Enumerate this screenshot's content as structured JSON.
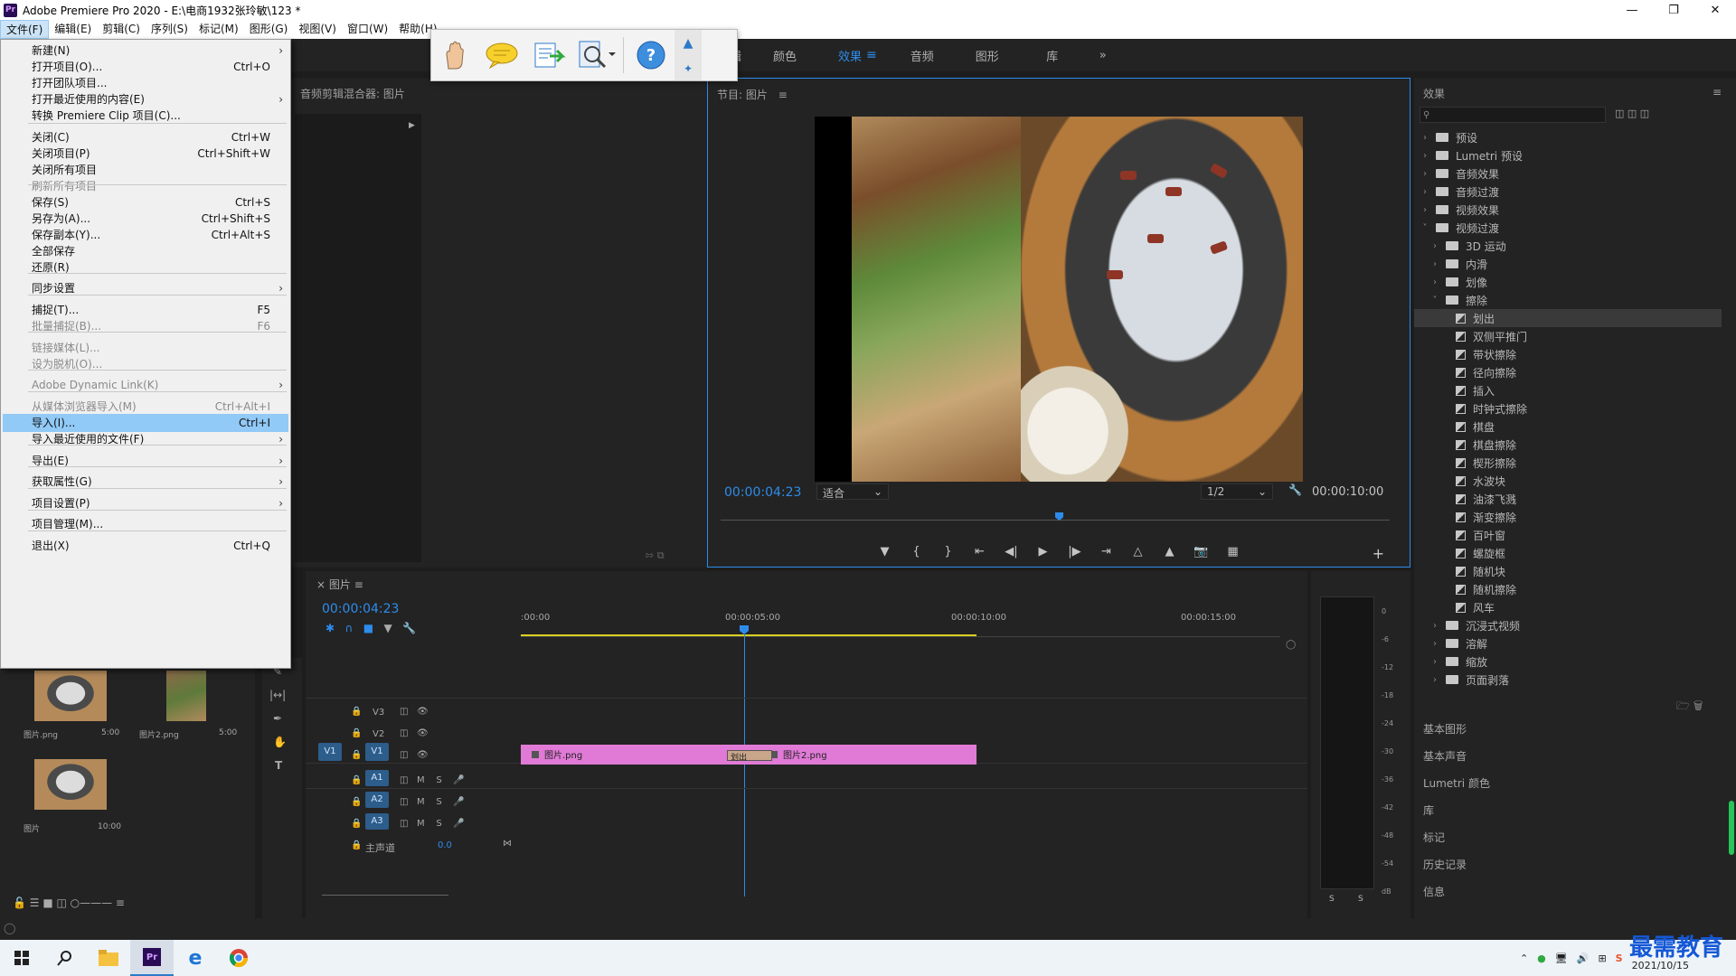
{
  "app": {
    "title": "Adobe Premiere Pro 2020 - E:\\电商1932张玲敏\\123 *"
  },
  "menubar": [
    "文件(F)",
    "编辑(E)",
    "剪辑(C)",
    "序列(S)",
    "标记(M)",
    "图形(G)",
    "视图(V)",
    "窗口(W)",
    "帮助(H)"
  ],
  "workspaces": [
    "编辑",
    "颜色",
    "效果",
    "音频",
    "图形",
    "库"
  ],
  "file_menu": [
    {
      "label": "新建(N)",
      "shortcut": "",
      "submenu": true,
      "disabled": false
    },
    {
      "label": "打开项目(O)...",
      "shortcut": "Ctrl+O",
      "submenu": false,
      "disabled": false
    },
    {
      "label": "打开团队项目...",
      "shortcut": "",
      "submenu": false,
      "disabled": false
    },
    {
      "label": "打开最近使用的内容(E)",
      "shortcut": "",
      "submenu": true,
      "disabled": false
    },
    {
      "label": "转换 Premiere Clip 项目(C)...",
      "shortcut": "",
      "submenu": false,
      "disabled": false
    },
    {
      "label": "关闭(C)",
      "shortcut": "Ctrl+W",
      "submenu": false,
      "disabled": false
    },
    {
      "label": "关闭项目(P)",
      "shortcut": "Ctrl+Shift+W",
      "submenu": false,
      "disabled": false
    },
    {
      "label": "关闭所有项目",
      "shortcut": "",
      "submenu": false,
      "disabled": false
    },
    {
      "label": "刷新所有项目",
      "shortcut": "",
      "submenu": false,
      "disabled": true
    },
    {
      "label": "保存(S)",
      "shortcut": "Ctrl+S",
      "submenu": false,
      "disabled": false
    },
    {
      "label": "另存为(A)...",
      "shortcut": "Ctrl+Shift+S",
      "submenu": false,
      "disabled": false
    },
    {
      "label": "保存副本(Y)...",
      "shortcut": "Ctrl+Alt+S",
      "submenu": false,
      "disabled": false
    },
    {
      "label": "全部保存",
      "shortcut": "",
      "submenu": false,
      "disabled": false
    },
    {
      "label": "还原(R)",
      "shortcut": "",
      "submenu": false,
      "disabled": false
    },
    {
      "label": "同步设置",
      "shortcut": "",
      "submenu": true,
      "disabled": false
    },
    {
      "label": "捕捉(T)...",
      "shortcut": "F5",
      "submenu": false,
      "disabled": false
    },
    {
      "label": "批量捕捉(B)...",
      "shortcut": "F6",
      "submenu": false,
      "disabled": true
    },
    {
      "label": "链接媒体(L)...",
      "shortcut": "",
      "submenu": false,
      "disabled": true
    },
    {
      "label": "设为脱机(O)...",
      "shortcut": "",
      "submenu": false,
      "disabled": true
    },
    {
      "label": "Adobe Dynamic Link(K)",
      "shortcut": "",
      "submenu": true,
      "disabled": true
    },
    {
      "label": "从媒体浏览器导入(M)",
      "shortcut": "Ctrl+Alt+I",
      "submenu": false,
      "disabled": true
    },
    {
      "label": "导入(I)...",
      "shortcut": "Ctrl+I",
      "submenu": false,
      "disabled": false
    },
    {
      "label": "导入最近使用的文件(F)",
      "shortcut": "",
      "submenu": true,
      "disabled": false
    },
    {
      "label": "导出(E)",
      "shortcut": "",
      "submenu": true,
      "disabled": false
    },
    {
      "label": "获取属性(G)",
      "shortcut": "",
      "submenu": true,
      "disabled": false
    },
    {
      "label": "项目设置(P)",
      "shortcut": "",
      "submenu": true,
      "disabled": false
    },
    {
      "label": "项目管理(M)...",
      "shortcut": "",
      "submenu": false,
      "disabled": false
    },
    {
      "label": "退出(X)",
      "shortcut": "Ctrl+Q",
      "submenu": false,
      "disabled": false
    }
  ],
  "mixer": {
    "title": "音频剪辑混合器: 图片"
  },
  "program": {
    "title": "节目: 图片",
    "timecode": "00:00:04:23",
    "fit": "适合",
    "resolution": "1/2",
    "duration": "00:00:10:00"
  },
  "effects": {
    "title": "效果",
    "tree": [
      {
        "label": "预设",
        "level": 0,
        "type": "folder",
        "open": false
      },
      {
        "label": "Lumetri 预设",
        "level": 0,
        "type": "folder",
        "open": false
      },
      {
        "label": "音频效果",
        "level": 0,
        "type": "folder",
        "open": false
      },
      {
        "label": "音频过渡",
        "level": 0,
        "type": "folder",
        "open": false
      },
      {
        "label": "视频效果",
        "level": 0,
        "type": "folder",
        "open": false
      },
      {
        "label": "视频过渡",
        "level": 0,
        "type": "folder",
        "open": true
      },
      {
        "label": "3D 运动",
        "level": 1,
        "type": "folder",
        "open": false
      },
      {
        "label": "内滑",
        "level": 1,
        "type": "folder",
        "open": false
      },
      {
        "label": "划像",
        "level": 1,
        "type": "folder",
        "open": false
      },
      {
        "label": "擦除",
        "level": 1,
        "type": "folder",
        "open": true
      },
      {
        "label": "划出",
        "level": 2,
        "type": "fx",
        "selected": true
      },
      {
        "label": "双侧平推门",
        "level": 2,
        "type": "fx"
      },
      {
        "label": "带状擦除",
        "level": 2,
        "type": "fx"
      },
      {
        "label": "径向擦除",
        "level": 2,
        "type": "fx"
      },
      {
        "label": "插入",
        "level": 2,
        "type": "fx"
      },
      {
        "label": "时钟式擦除",
        "level": 2,
        "type": "fx"
      },
      {
        "label": "棋盘",
        "level": 2,
        "type": "fx"
      },
      {
        "label": "棋盘擦除",
        "level": 2,
        "type": "fx"
      },
      {
        "label": "楔形擦除",
        "level": 2,
        "type": "fx"
      },
      {
        "label": "水波块",
        "level": 2,
        "type": "fx"
      },
      {
        "label": "油漆飞溅",
        "level": 2,
        "type": "fx"
      },
      {
        "label": "渐变擦除",
        "level": 2,
        "type": "fx"
      },
      {
        "label": "百叶窗",
        "level": 2,
        "type": "fx"
      },
      {
        "label": "螺旋框",
        "level": 2,
        "type": "fx"
      },
      {
        "label": "随机块",
        "level": 2,
        "type": "fx"
      },
      {
        "label": "随机擦除",
        "level": 2,
        "type": "fx"
      },
      {
        "label": "风车",
        "level": 2,
        "type": "fx"
      },
      {
        "label": "沉浸式视频",
        "level": 1,
        "type": "folder",
        "open": false
      },
      {
        "label": "溶解",
        "level": 1,
        "type": "folder",
        "open": false
      },
      {
        "label": "缩放",
        "level": 1,
        "type": "folder",
        "open": false
      },
      {
        "label": "页面剥落",
        "level": 1,
        "type": "folder",
        "open": false
      }
    ],
    "sections": [
      "基本图形",
      "基本声音",
      "Lumetri 颜色",
      "库",
      "标记",
      "历史记录",
      "信息"
    ]
  },
  "timeline": {
    "tab": "图片",
    "timecode": "00:00:04:23",
    "ruler": [
      ":00:00",
      "00:00:05:00",
      "00:00:10:00",
      "00:00:15:00"
    ],
    "video_tracks": [
      "V3",
      "V2",
      "V1"
    ],
    "audio_tracks": [
      "A1",
      "A2",
      "A3"
    ],
    "master_label": "主声道",
    "master_value": "0.0",
    "clip1": "图片.png",
    "clip2": "图片2.png",
    "transition": "划出"
  },
  "meter": {
    "scale": [
      "0",
      "-6",
      "-12",
      "-18",
      "-24",
      "-30",
      "-36",
      "-42",
      "-48",
      "-54",
      "dB"
    ],
    "solo": [
      "S",
      "S"
    ]
  },
  "project": {
    "items": [
      {
        "name": "图片.png",
        "dur": "5:00"
      },
      {
        "name": "图片2.png",
        "dur": "5:00"
      },
      {
        "name": "图片",
        "dur": "10:00"
      }
    ]
  },
  "tray": {
    "date": "2021/10/15",
    "watermark": "最需教育"
  }
}
